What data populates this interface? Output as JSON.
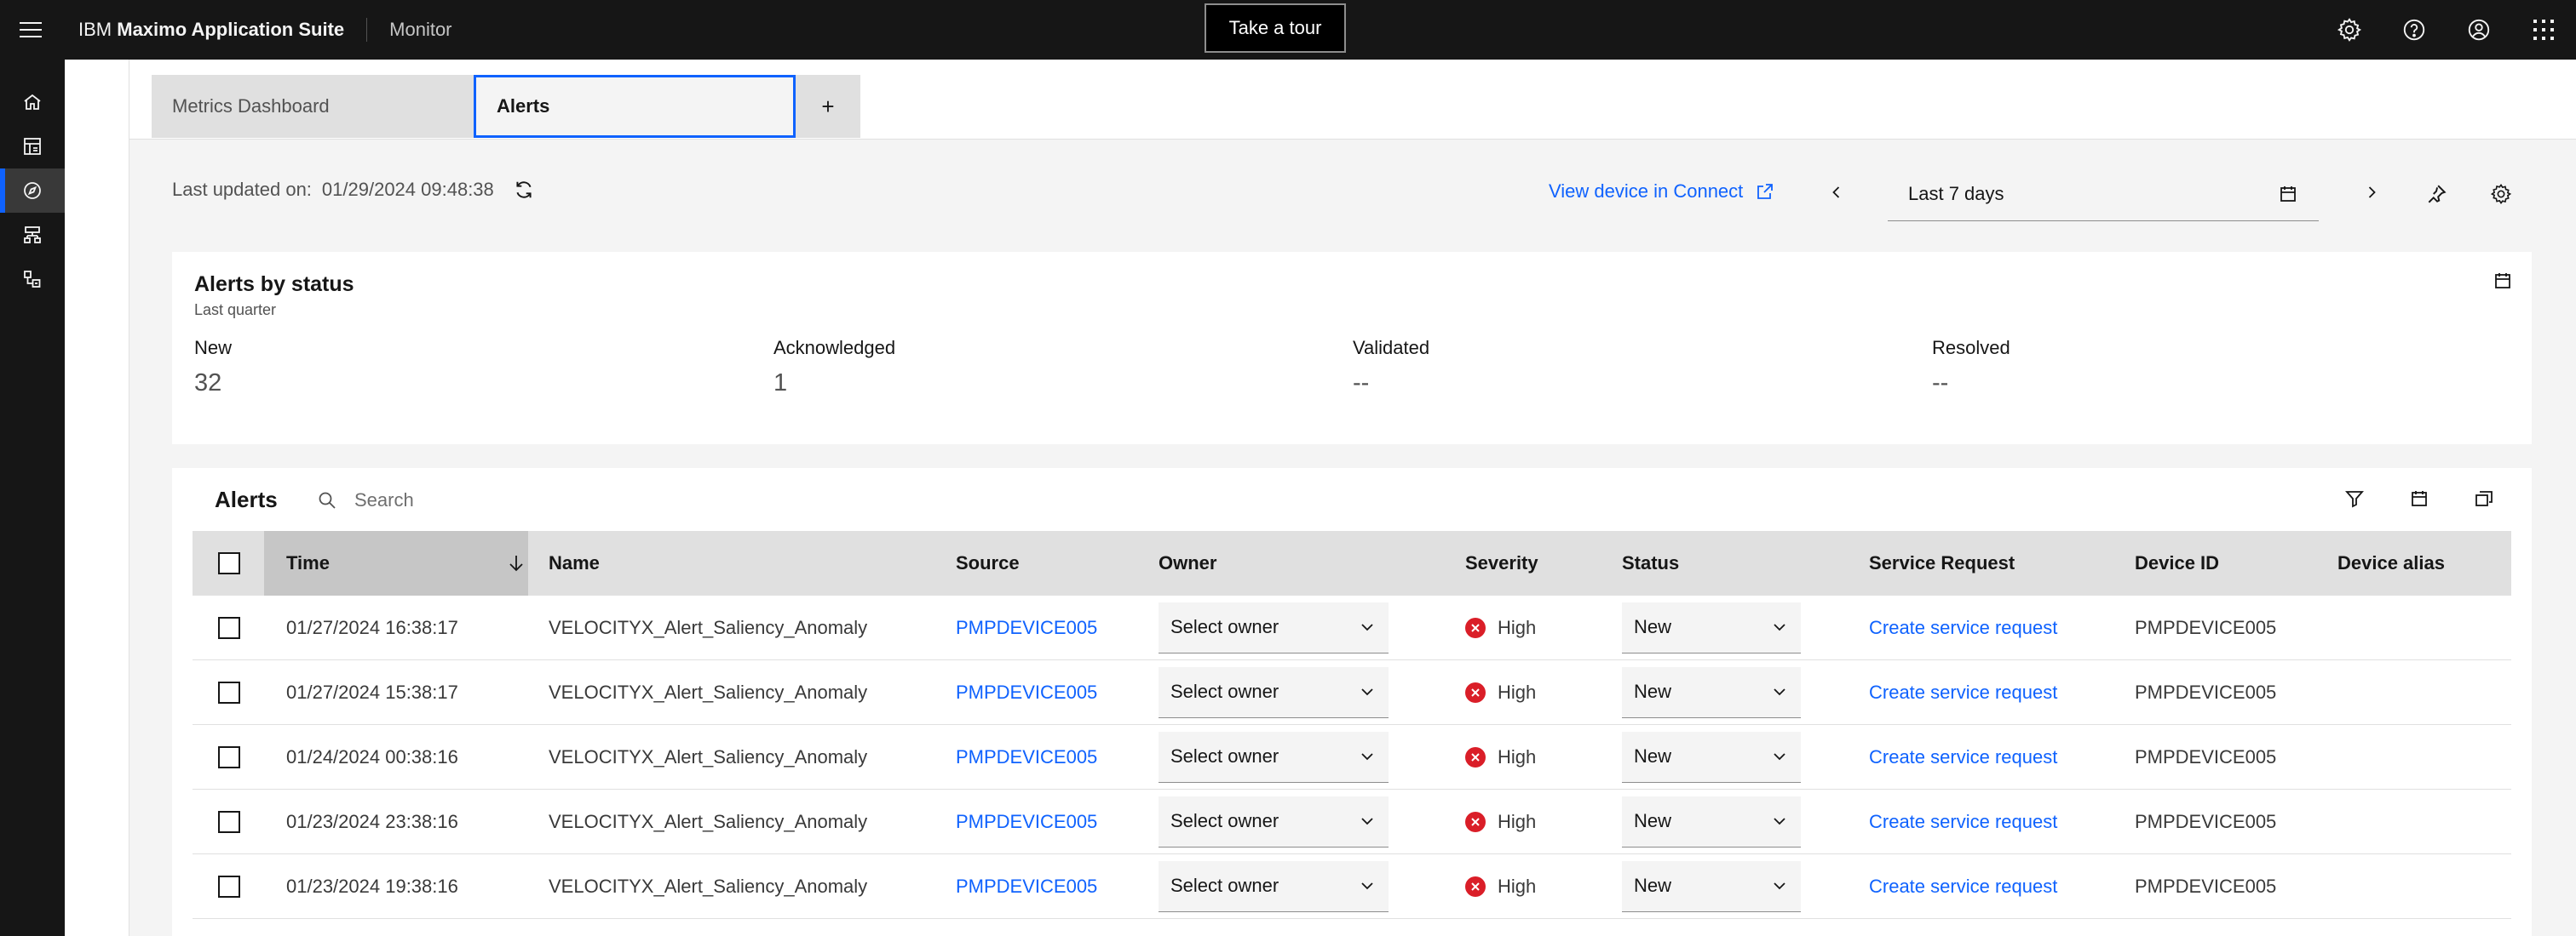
{
  "header": {
    "brand_prefix": "IBM",
    "brand_name": "Maximo Application Suite",
    "app_name": "Monitor",
    "tour_label": "Take a tour"
  },
  "tabs": [
    {
      "label": "Metrics Dashboard",
      "active": false
    },
    {
      "label": "Alerts",
      "active": true
    },
    {
      "label": "+",
      "active": false
    }
  ],
  "status_bar": {
    "last_updated_label": "Last updated on:",
    "last_updated_value": "01/29/2024 09:48:38",
    "view_device_link": "View device in Connect",
    "date_range": "Last 7 days"
  },
  "status_card": {
    "title": "Alerts by status",
    "subtitle": "Last quarter",
    "stats": [
      {
        "label": "New",
        "value": "32"
      },
      {
        "label": "Acknowledged",
        "value": "1"
      },
      {
        "label": "Validated",
        "value": "--"
      },
      {
        "label": "Resolved",
        "value": "--"
      }
    ]
  },
  "alerts_table": {
    "title": "Alerts",
    "search_placeholder": "Search",
    "columns": [
      "Time",
      "Name",
      "Source",
      "Owner",
      "Severity",
      "Status",
      "Service Request",
      "Device ID",
      "Device alias"
    ],
    "rows": [
      {
        "time": "01/27/2024 16:38:17",
        "name": "VELOCITYX_Alert_Saliency_Anomaly",
        "source": "PMPDEVICE005",
        "owner": "Select owner",
        "severity": "High",
        "status": "New",
        "service_request": "Create service request",
        "device_id": "PMPDEVICE005",
        "device_alias": ""
      },
      {
        "time": "01/27/2024 15:38:17",
        "name": "VELOCITYX_Alert_Saliency_Anomaly",
        "source": "PMPDEVICE005",
        "owner": "Select owner",
        "severity": "High",
        "status": "New",
        "service_request": "Create service request",
        "device_id": "PMPDEVICE005",
        "device_alias": ""
      },
      {
        "time": "01/24/2024 00:38:16",
        "name": "VELOCITYX_Alert_Saliency_Anomaly",
        "source": "PMPDEVICE005",
        "owner": "Select owner",
        "severity": "High",
        "status": "New",
        "service_request": "Create service request",
        "device_id": "PMPDEVICE005",
        "device_alias": ""
      },
      {
        "time": "01/23/2024 23:38:16",
        "name": "VELOCITYX_Alert_Saliency_Anomaly",
        "source": "PMPDEVICE005",
        "owner": "Select owner",
        "severity": "High",
        "status": "New",
        "service_request": "Create service request",
        "device_id": "PMPDEVICE005",
        "device_alias": ""
      },
      {
        "time": "01/23/2024 19:38:16",
        "name": "VELOCITYX_Alert_Saliency_Anomaly",
        "source": "PMPDEVICE005",
        "owner": "Select owner",
        "severity": "High",
        "status": "New",
        "service_request": "Create service request",
        "device_id": "PMPDEVICE005",
        "device_alias": ""
      }
    ]
  },
  "icons": {
    "menu": "hamburger-menu-icon",
    "settings": "gear-icon",
    "help": "help-icon",
    "user": "user-avatar-icon",
    "apps": "app-switcher-icon",
    "rail": [
      "home-icon",
      "dashboard-icon",
      "compass-icon",
      "hierarchy-icon",
      "data-structure-icon"
    ]
  },
  "colors": {
    "accent": "#0f62fe",
    "severity_high": "#da1e28",
    "header_bg": "#161616"
  }
}
